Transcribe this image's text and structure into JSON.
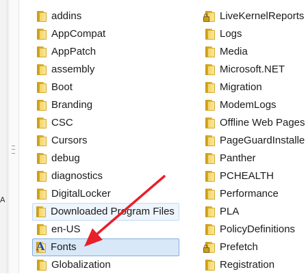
{
  "left_column": [
    {
      "label": "addins",
      "icon": "folder-icon"
    },
    {
      "label": "AppCompat",
      "icon": "folder-icon"
    },
    {
      "label": "AppPatch",
      "icon": "folder-icon"
    },
    {
      "label": "assembly",
      "icon": "folder-icon"
    },
    {
      "label": "Boot",
      "icon": "folder-icon"
    },
    {
      "label": "Branding",
      "icon": "folder-icon"
    },
    {
      "label": "CSC",
      "icon": "folder-icon"
    },
    {
      "label": "Cursors",
      "icon": "folder-icon"
    },
    {
      "label": "debug",
      "icon": "folder-icon"
    },
    {
      "label": "diagnostics",
      "icon": "folder-icon"
    },
    {
      "label": "DigitalLocker",
      "icon": "folder-icon"
    },
    {
      "label": "Downloaded Program Files",
      "icon": "folder-icon",
      "state": "hover"
    },
    {
      "label": "en-US",
      "icon": "folder-icon"
    },
    {
      "label": "Fonts",
      "icon": "fonts-folder-icon",
      "state": "selected"
    },
    {
      "label": "Globalization",
      "icon": "folder-icon"
    }
  ],
  "right_column": [
    {
      "label": "LiveKernelReports",
      "icon": "locked-folder-icon"
    },
    {
      "label": "Logs",
      "icon": "folder-icon"
    },
    {
      "label": "Media",
      "icon": "folder-icon"
    },
    {
      "label": "Microsoft.NET",
      "icon": "folder-icon"
    },
    {
      "label": "Migration",
      "icon": "folder-icon"
    },
    {
      "label": "ModemLogs",
      "icon": "folder-icon"
    },
    {
      "label": "Offline Web Pages",
      "icon": "folder-icon"
    },
    {
      "label": "PageGuardInstalle",
      "icon": "folder-icon"
    },
    {
      "label": "Panther",
      "icon": "folder-icon"
    },
    {
      "label": "PCHEALTH",
      "icon": "folder-icon"
    },
    {
      "label": "Performance",
      "icon": "folder-icon"
    },
    {
      "label": "PLA",
      "icon": "folder-icon"
    },
    {
      "label": "PolicyDefinitions",
      "icon": "folder-icon"
    },
    {
      "label": "Prefetch",
      "icon": "locked-folder-icon"
    },
    {
      "label": "Registration",
      "icon": "folder-icon"
    }
  ],
  "nav_pane": {
    "partial_glyph": "A"
  },
  "annotation": {
    "icon": "red-arrow-icon",
    "color": "#e8202a",
    "points_to": "Fonts"
  },
  "colors": {
    "selected_bg": "#d8e8f8",
    "selected_border": "#84acdd",
    "hover_bg": "#eef5fc",
    "hover_border": "#c2dbf4"
  }
}
